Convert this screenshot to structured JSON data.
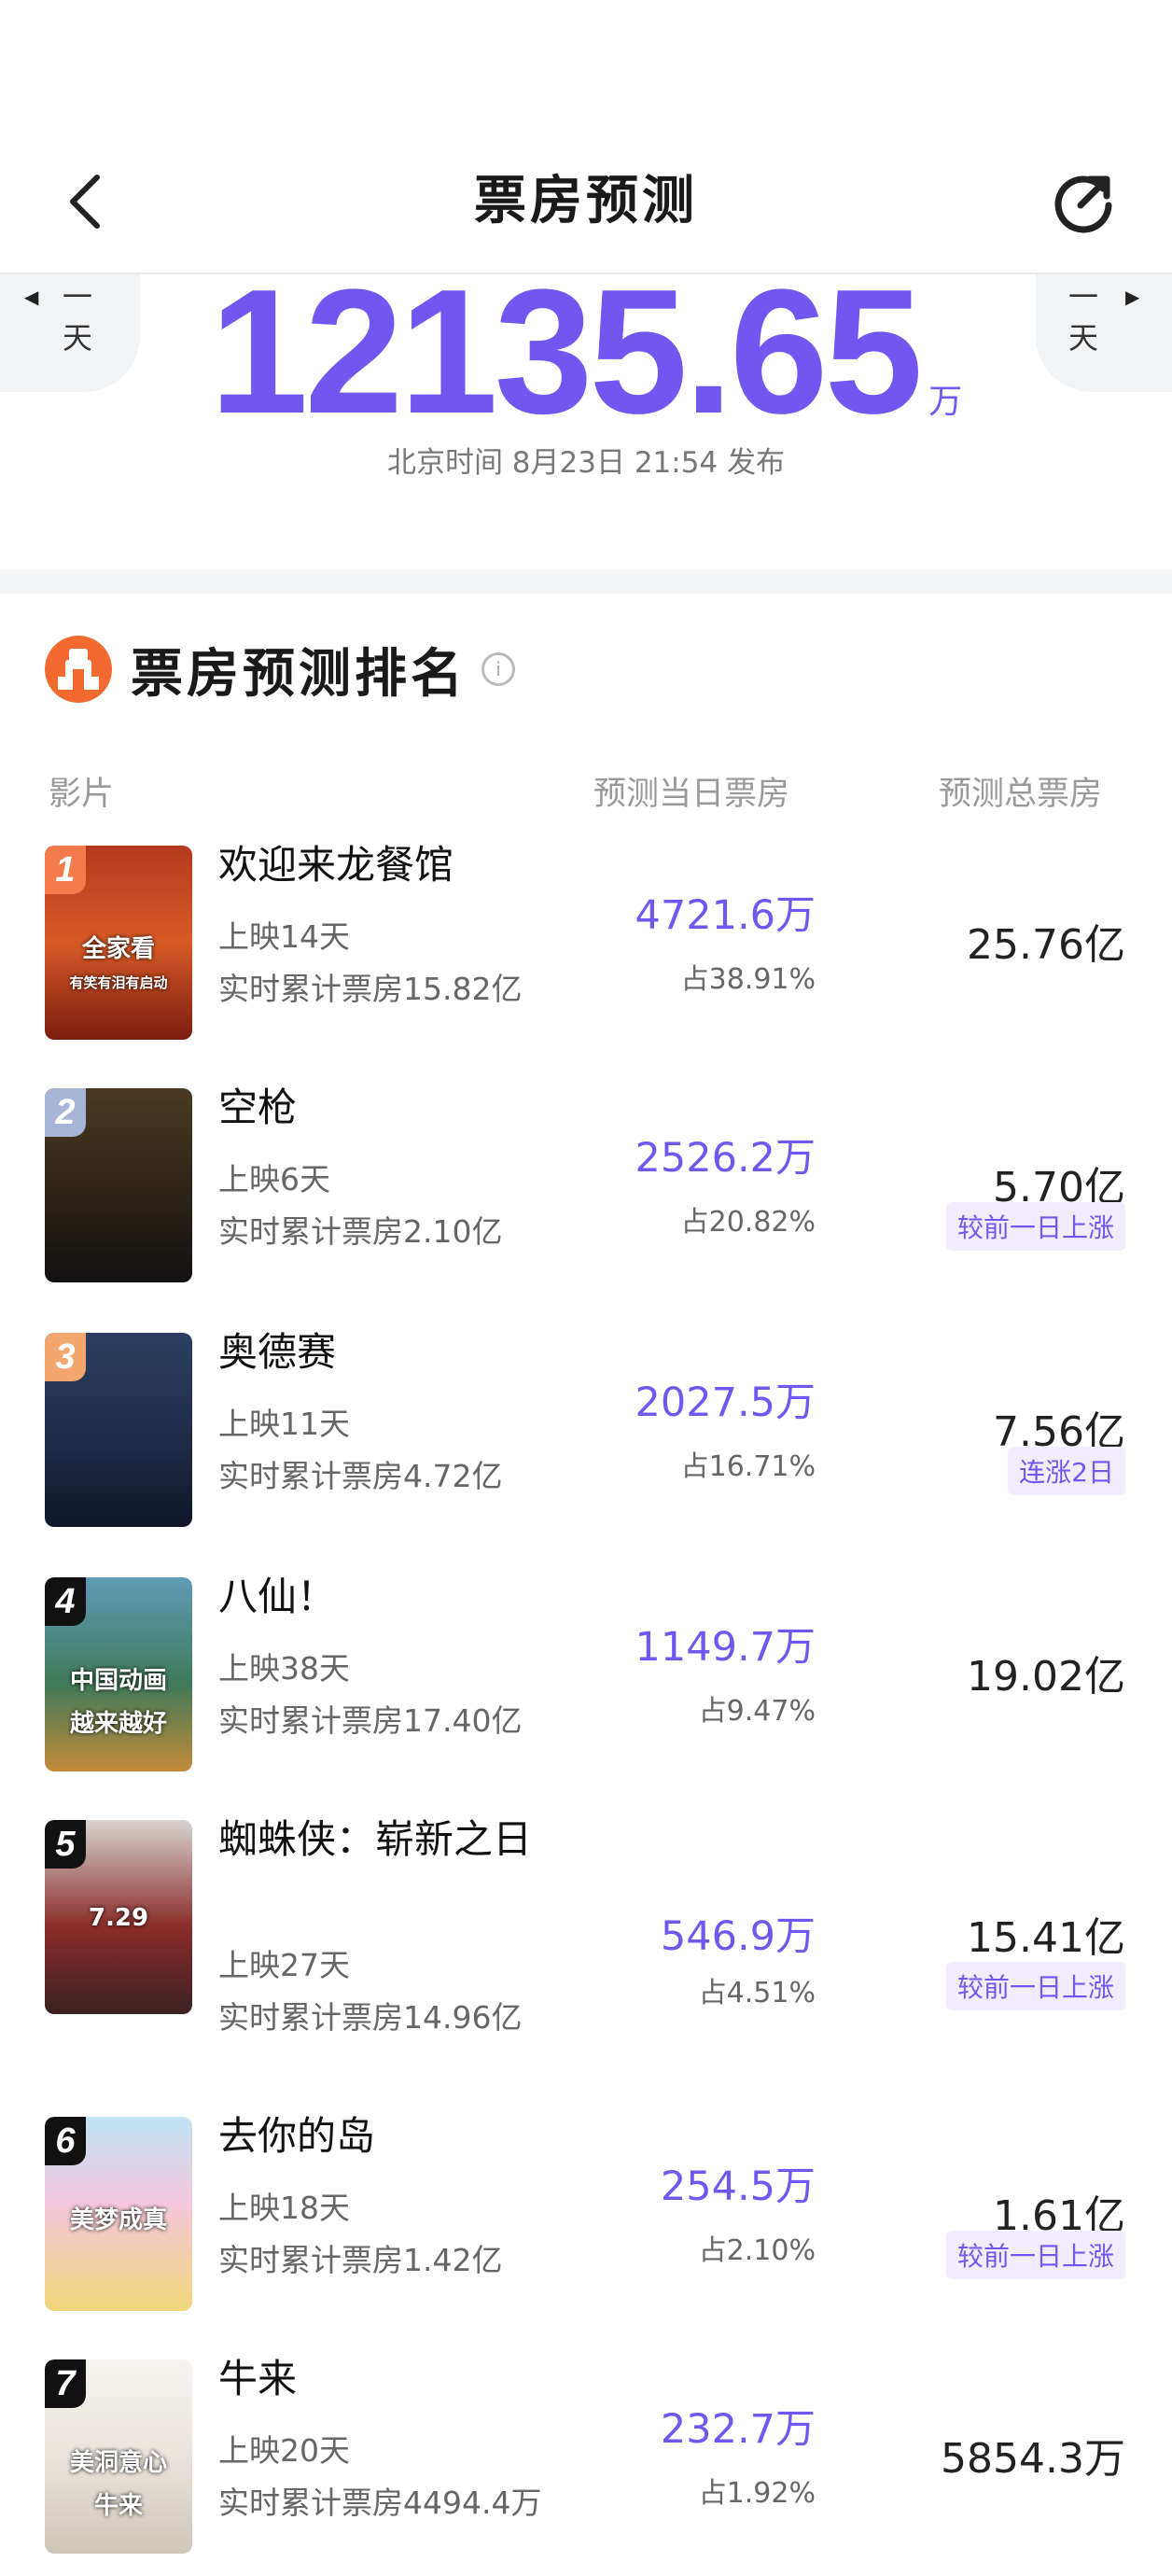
{
  "header": {
    "title": "票房预测",
    "back_icon": "chevron-left-icon",
    "refresh_icon": "refresh-icon"
  },
  "hero": {
    "prev_label": "一天",
    "next_label": "一天",
    "amount": "12135.65",
    "unit": "万",
    "publish_time": "北京时间 8月23日 21:54 发布",
    "accent": "#7256f0"
  },
  "section": {
    "title": "票房预测排名",
    "info_icon": "info-icon"
  },
  "columns": {
    "film": "影片",
    "day": "预测当日票房",
    "total": "预测总票房"
  },
  "rank_colors": [
    "#f47b4b",
    "#a7b6d8",
    "#f3a76d",
    "#111111",
    "#111111",
    "#111111",
    "#111111"
  ],
  "movies": [
    {
      "rank": "1",
      "name": "欢迎来龙餐馆",
      "days": "上映14天",
      "cum": "实时累计票房15.82亿",
      "day_box": "4721.6万",
      "share": "占38.91%",
      "total": "25.76亿",
      "badge": ""
    },
    {
      "rank": "2",
      "name": "空枪",
      "days": "上映6天",
      "cum": "实时累计票房2.10亿",
      "day_box": "2526.2万",
      "share": "占20.82%",
      "total": "5.70亿",
      "badge": "较前一日上涨"
    },
    {
      "rank": "3",
      "name": "奥德赛",
      "days": "上映11天",
      "cum": "实时累计票房4.72亿",
      "day_box": "2027.5万",
      "share": "占16.71%",
      "total": "7.56亿",
      "badge": "连涨2日"
    },
    {
      "rank": "4",
      "name": "八仙！",
      "days": "上映38天",
      "cum": "实时累计票房17.40亿",
      "day_box": "1149.7万",
      "share": "占9.47%",
      "total": "19.02亿",
      "badge": ""
    },
    {
      "rank": "5",
      "name": "蜘蛛侠：崭新之日",
      "days": "上映27天",
      "cum": "实时累计票房14.96亿",
      "day_box": "546.9万",
      "share": "占4.51%",
      "total": "15.41亿",
      "badge": "较前一日上涨"
    },
    {
      "rank": "6",
      "name": "去你的岛",
      "days": "上映18天",
      "cum": "实时累计票房1.42亿",
      "day_box": "254.5万",
      "share": "占2.10%",
      "total": "1.61亿",
      "badge": "较前一日上涨"
    },
    {
      "rank": "7",
      "name": "牛来",
      "days": "上映20天",
      "cum": "实时累计票房4494.4万",
      "day_box": "232.7万",
      "share": "占1.92%",
      "total": "5854.3万",
      "badge": ""
    }
  ],
  "posters": {
    "1": {
      "art": [
        "全家看",
        "有笑有泪有启动"
      ]
    },
    "4": {
      "art": [
        "中国动画",
        "越来越好"
      ]
    },
    "5": {
      "art": [
        "7.29"
      ]
    },
    "6": {
      "art": [
        "美梦成真"
      ]
    },
    "7": {
      "art": [
        "美洞意心",
        "牛来"
      ]
    }
  }
}
